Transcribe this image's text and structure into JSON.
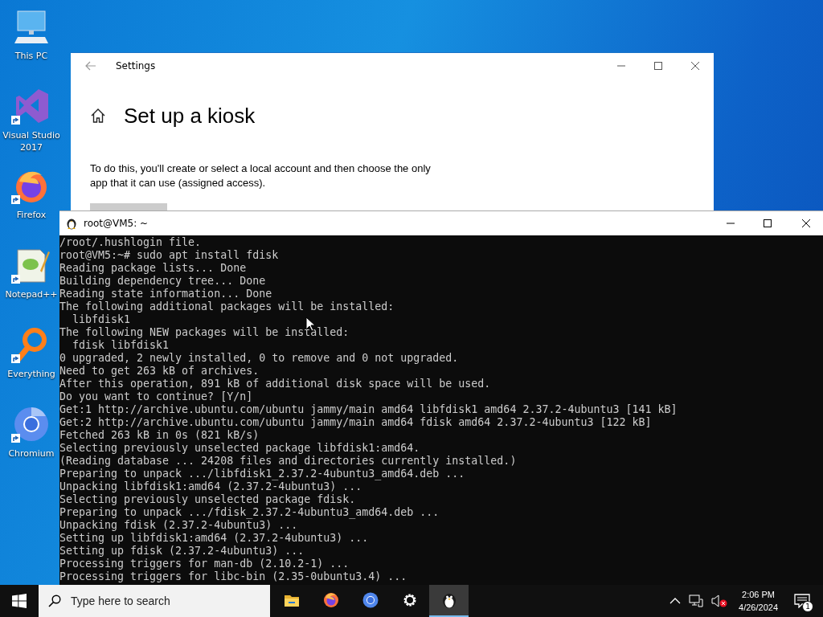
{
  "desktop_icons": [
    {
      "label": "This PC",
      "kind": "computer",
      "shortcut": false
    },
    {
      "label": "Visual Studio 2017",
      "kind": "visual-studio",
      "shortcut": true
    },
    {
      "label": "Firefox",
      "kind": "firefox",
      "shortcut": true
    },
    {
      "label": "Notepad++",
      "kind": "notepad",
      "shortcut": true
    },
    {
      "label": "Everything",
      "kind": "everything",
      "shortcut": true
    },
    {
      "label": "Chromium",
      "kind": "chromium",
      "shortcut": true
    }
  ],
  "settings_window": {
    "title": "Settings",
    "heading": "Set up a kiosk",
    "description": "To do this, you'll create or select a local account and then choose the only app that it can use (assigned access)."
  },
  "terminal_window": {
    "title": "root@VM5: ~",
    "lines": [
      "/root/.hushlogin file.",
      "root@VM5:~# sudo apt install fdisk",
      "Reading package lists... Done",
      "Building dependency tree... Done",
      "Reading state information... Done",
      "The following additional packages will be installed:",
      "  libfdisk1",
      "The following NEW packages will be installed:",
      "  fdisk libfdisk1",
      "0 upgraded, 2 newly installed, 0 to remove and 0 not upgraded.",
      "Need to get 263 kB of archives.",
      "After this operation, 891 kB of additional disk space will be used.",
      "Do you want to continue? [Y/n]",
      "Get:1 http://archive.ubuntu.com/ubuntu jammy/main amd64 libfdisk1 amd64 2.37.2-4ubuntu3 [141 kB]",
      "Get:2 http://archive.ubuntu.com/ubuntu jammy/main amd64 fdisk amd64 2.37.2-4ubuntu3 [122 kB]",
      "Fetched 263 kB in 0s (821 kB/s)",
      "Selecting previously unselected package libfdisk1:amd64.",
      "(Reading database ... 24208 files and directories currently installed.)",
      "Preparing to unpack .../libfdisk1_2.37.2-4ubuntu3_amd64.deb ...",
      "Unpacking libfdisk1:amd64 (2.37.2-4ubuntu3) ...",
      "Selecting previously unselected package fdisk.",
      "Preparing to unpack .../fdisk_2.37.2-4ubuntu3_amd64.deb ...",
      "Unpacking fdisk (2.37.2-4ubuntu3) ...",
      "Setting up libfdisk1:amd64 (2.37.2-4ubuntu3) ...",
      "Setting up fdisk (2.37.2-4ubuntu3) ...",
      "Processing triggers for man-db (2.10.2-1) ...",
      "Processing triggers for libc-bin (2.35-0ubuntu3.4) ..."
    ]
  },
  "taskbar": {
    "search": {
      "placeholder": "Type here to search"
    },
    "apps": [
      {
        "kind": "folder",
        "selected": false
      },
      {
        "kind": "firefox",
        "selected": false
      },
      {
        "kind": "chromium",
        "selected": false
      },
      {
        "kind": "gear",
        "selected": false
      },
      {
        "kind": "penguin",
        "selected": true
      }
    ],
    "volume_muted": true,
    "time": "2:06 PM",
    "date": "4/26/2024",
    "notification_count": "1"
  }
}
